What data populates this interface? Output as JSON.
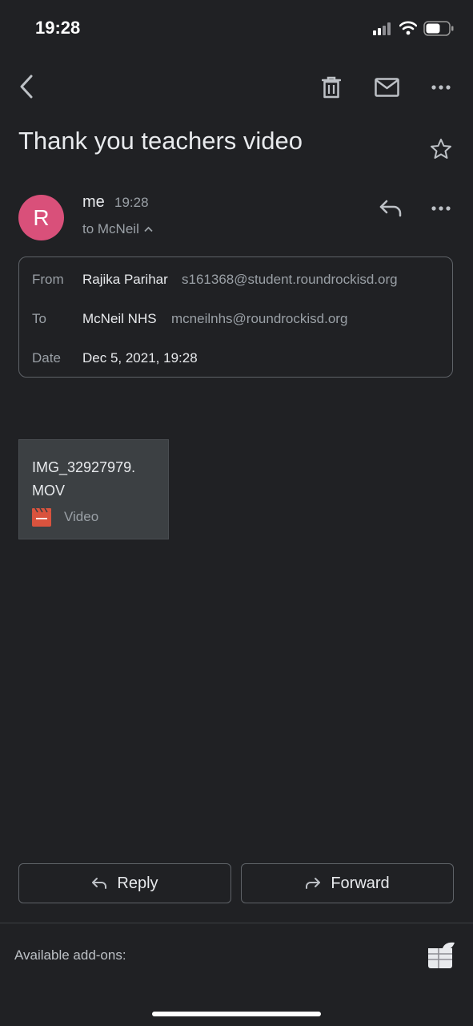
{
  "status_bar": {
    "time": "19:28"
  },
  "toolbar": {
    "back_icon": "chevron-left-icon",
    "delete_icon": "trash-icon",
    "mark_unread_icon": "mail-icon",
    "more_icon": "more-horizontal-icon"
  },
  "email": {
    "subject": "Thank you teachers video",
    "avatar_letter": "R",
    "avatar_color": "#d9507a",
    "sender": "me",
    "time": "19:28",
    "to_summary": "to McNeil",
    "details": {
      "from_label": "From",
      "from_name": "Rajika Parihar",
      "from_email": "s161368@student.roundrockisd.org",
      "to_label": "To",
      "to_name": "McNeil NHS",
      "to_email": "mcneilnhs@roundrockisd.org",
      "date_label": "Date",
      "date_value": "Dec 5, 2021, 19:28"
    },
    "attachment": {
      "name": "IMG_32927979.\nMOV",
      "type_label": "Video"
    }
  },
  "actions": {
    "reply_label": "Reply",
    "forward_label": "Forward"
  },
  "addons": {
    "label": "Available add-ons:"
  }
}
